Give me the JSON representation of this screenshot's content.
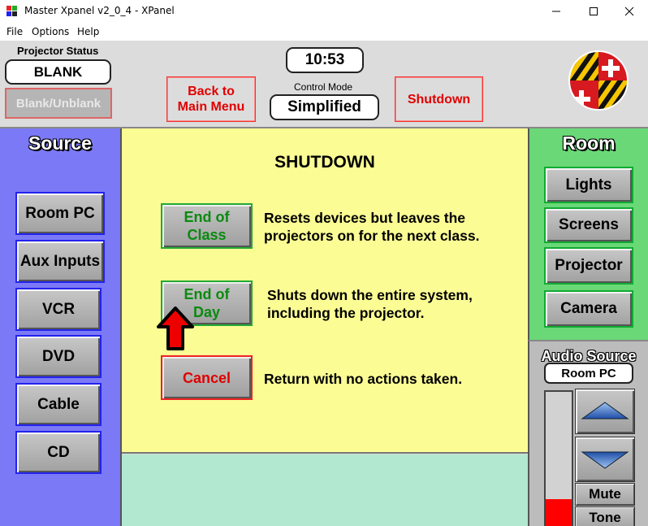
{
  "window": {
    "title": "Master Xpanel v2_0_4 - XPanel",
    "controls": {
      "minimize": "minimize",
      "maximize": "maximize",
      "close": "close"
    }
  },
  "menu": {
    "file": "File",
    "options": "Options",
    "help": "Help"
  },
  "header": {
    "projector_status_label": "Projector Status",
    "projector_status_value": "BLANK",
    "blank_unblank_label": "Blank/Unblank",
    "clock": "10:53",
    "back_label_line1": "Back to",
    "back_label_line2": "Main Menu",
    "control_mode_label": "Control Mode",
    "control_mode_value": "Simplified",
    "shutdown_label": "Shutdown"
  },
  "source": {
    "title": "Source",
    "buttons": [
      "Room PC",
      "Aux Inputs",
      "VCR",
      "DVD",
      "Cable",
      "CD"
    ]
  },
  "shutdown": {
    "title": "SHUTDOWN",
    "end_of_class": {
      "line1": "End of",
      "line2": "Class",
      "desc1": "Resets devices but leaves the",
      "desc2": "projectors on for the next class."
    },
    "end_of_day": {
      "line1": "End of",
      "line2": "Day",
      "desc1": "Shuts down the entire system,",
      "desc2": "including the projector."
    },
    "cancel": {
      "label": "Cancel",
      "desc": "Return with no actions taken."
    }
  },
  "room": {
    "title": "Room",
    "buttons": [
      "Lights",
      "Screens",
      "Projector",
      "Camera"
    ]
  },
  "audio": {
    "title": "Audio Source",
    "current_source": "Room PC",
    "volume_level": 0.2,
    "mute_label": "Mute",
    "tone_label": "Tone"
  },
  "colors": {
    "source_panel": "#7b79f5",
    "center_panel": "#fcfc95",
    "room_panel": "#6ad877",
    "alert_red": "#e00000"
  }
}
